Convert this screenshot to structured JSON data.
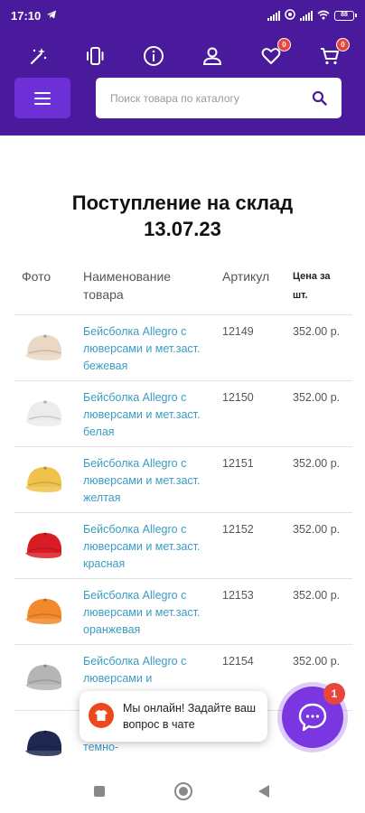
{
  "status_bar": {
    "time": "17:10",
    "battery": "88"
  },
  "header": {
    "icons": [
      "magic-wand-icon",
      "phone-vibrate-icon",
      "info-icon",
      "user-icon",
      "heart-icon",
      "cart-icon"
    ],
    "favorites_count": "0",
    "cart_count": "0",
    "search_placeholder": "Поиск товара по каталогу"
  },
  "page": {
    "title_line1": "Поступление на склад",
    "title_line2": "13.07.23"
  },
  "table": {
    "headers": {
      "photo": "Фото",
      "name": "Наименование товара",
      "sku": "Артикул",
      "price": "Цена за шт."
    },
    "rows": [
      {
        "name": "Бейсболка Allegro с люверсами и мет.заст. бежевая",
        "sku": "12149",
        "price": "352.00 р.",
        "color": "#ead8c4"
      },
      {
        "name": "Бейсболка Allegro с люверсами и мет.заст. белая",
        "sku": "12150",
        "price": "352.00 р.",
        "color": "#ececec"
      },
      {
        "name": "Бейсболка Allegro с люверсами и мет.заст. желтая",
        "sku": "12151",
        "price": "352.00 р.",
        "color": "#f0c24c"
      },
      {
        "name": "Бейсболка Allegro с люверсами и мет.заст. красная",
        "sku": "12152",
        "price": "352.00 р.",
        "color": "#d81c24"
      },
      {
        "name": "Бейсболка Allegro с люверсами и мет.заст. оранжевая",
        "sku": "12153",
        "price": "352.00 р.",
        "color": "#f2892a"
      },
      {
        "name": "Бейсболка Allegro с люверсами и",
        "sku": "12154",
        "price": "352.00 р.",
        "color": "#b5b5b5"
      },
      {
        "name": "люверсами и мет.заст. темно-",
        "sku": "",
        "price": "",
        "color": "#1e2850"
      }
    ]
  },
  "chat": {
    "message": "Мы онлайн! Задайте ваш вопрос в чате",
    "unread": "1"
  },
  "colors": {
    "header_bg": "#4a1a9c",
    "menu_button": "#6d2fd6",
    "link": "#3a9cc4",
    "chat_fab": "#7a36e0",
    "badge": "#e8453c"
  }
}
